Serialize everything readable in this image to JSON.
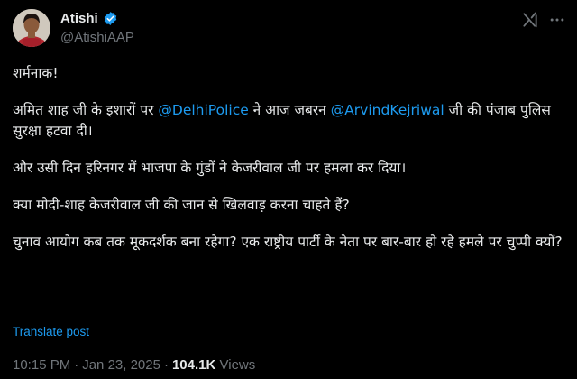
{
  "author": {
    "name": "Atishi",
    "handle": "@AtishiAAP",
    "verified_color": "#1d9bf0"
  },
  "header_icons": {
    "grok": "grok-icon",
    "more": "more-options-icon"
  },
  "tweet": {
    "p1": "शर्मनाक!",
    "p2_a": "अमित शाह जी के इशारों पर ",
    "p2_mention1": "@DelhiPolice",
    "p2_b": " ने आज जबरन ",
    "p2_mention2": "@ArvindKejriwal",
    "p2_c": " जी की पंजाब पुलिस सुरक्षा हटवा दी।",
    "p3": "और उसी दिन हरिनगर में भाजपा के गुंडों ने केजरीवाल जी पर हमला कर दिया।",
    "p4": "क्या मोदी-शाह केजरीवाल जी की जान से खिलवाड़ करना चाहते हैं?",
    "p5": "चुनाव आयोग कब तक मूकदर्शक बना रहेगा? एक राष्ट्रीय पार्टी के नेता पर बार-बार हो रहे हमले पर चुप्पी क्यों?"
  },
  "translate_label": "Translate post",
  "meta": {
    "time": "10:15 PM",
    "date": "Jan 23, 2025",
    "views_count": "104.1K",
    "views_label": "Views"
  },
  "colors": {
    "background": "#000000",
    "text": "#e7e9ea",
    "secondary": "#71767b",
    "accent": "#1d9bf0"
  }
}
